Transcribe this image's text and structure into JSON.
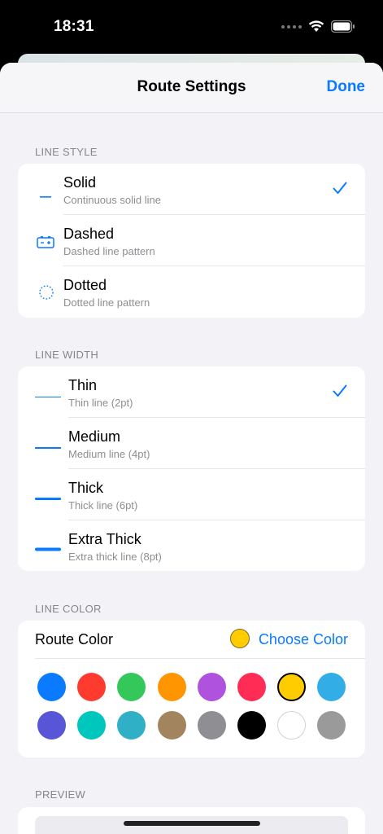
{
  "status": {
    "time": "18:31"
  },
  "nav": {
    "title": "Route Settings",
    "done": "Done"
  },
  "line_style": {
    "header": "LINE STYLE",
    "items": [
      {
        "title": "Solid",
        "subtitle": "Continuous solid line",
        "icon": "solid-line-icon",
        "selected": true
      },
      {
        "title": "Dashed",
        "subtitle": "Dashed line pattern",
        "icon": "dashed-pattern-icon",
        "selected": false
      },
      {
        "title": "Dotted",
        "subtitle": "Dotted line pattern",
        "icon": "dotted-circle-icon",
        "selected": false
      }
    ]
  },
  "line_width": {
    "header": "LINE WIDTH",
    "items": [
      {
        "title": "Thin",
        "subtitle": "Thin line (2pt)",
        "weight": 2,
        "selected": true
      },
      {
        "title": "Medium",
        "subtitle": "Medium line (4pt)",
        "weight": 4,
        "selected": false
      },
      {
        "title": "Thick",
        "subtitle": "Thick line (6pt)",
        "weight": 6,
        "selected": false
      },
      {
        "title": "Extra Thick",
        "subtitle": "Extra thick line (8pt)",
        "weight": 8,
        "selected": false
      }
    ]
  },
  "line_color": {
    "header": "LINE COLOR",
    "label": "Route Color",
    "choose": "Choose Color",
    "current": "#FFCC00",
    "swatches": [
      "#0A7AFF",
      "#FF3B30",
      "#34C759",
      "#FF9500",
      "#AF52DE",
      "#FF2D55",
      "#FFCC00",
      "#32ADE6",
      "#5856D6",
      "#00C7BE",
      "#30B0C7",
      "#A2845E",
      "#8E8E93",
      "#000000",
      "#FFFFFF",
      "#9A9A9A"
    ],
    "selected_index": 6
  },
  "preview": {
    "header": "PREVIEW"
  },
  "colors": {
    "accent": "#0A7AFF"
  }
}
